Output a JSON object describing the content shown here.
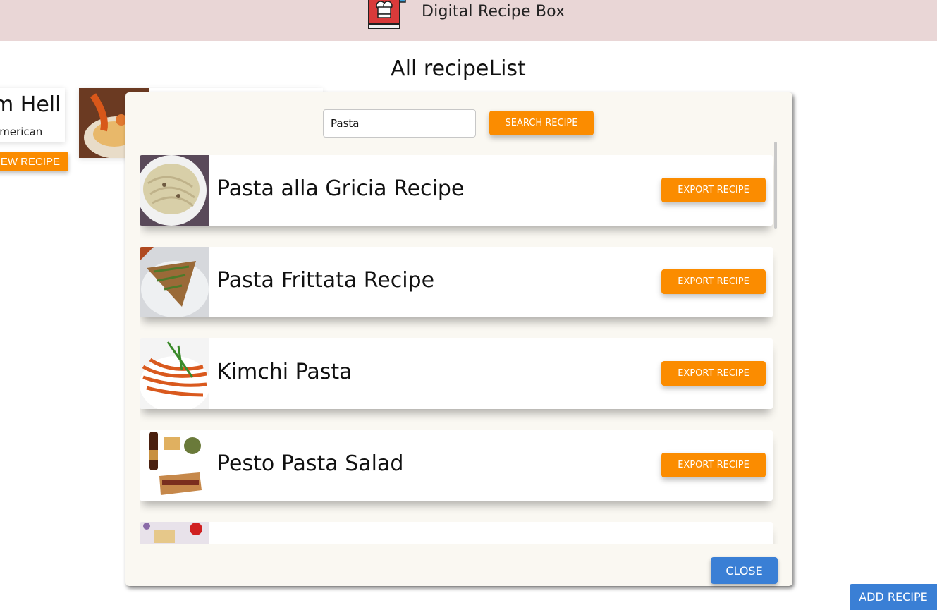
{
  "header": {
    "title": "Digital Recipe Box",
    "logo_icon": "chef-recipe-book-icon"
  },
  "page": {
    "title": "All recipeList"
  },
  "background_cards": [
    {
      "title": "m Hell",
      "cuisine": "american",
      "button": "EW RECIPE"
    }
  ],
  "modal": {
    "search": {
      "value": "Pasta",
      "button": "SEARCH RECIPE"
    },
    "results": [
      {
        "name": "Pasta alla Gricia Recipe",
        "button": "EXPORT RECIPE"
      },
      {
        "name": "Pasta Frittata Recipe",
        "button": "EXPORT RECIPE"
      },
      {
        "name": "Kimchi Pasta",
        "button": "EXPORT RECIPE"
      },
      {
        "name": "Pesto Pasta Salad",
        "button": "EXPORT RECIPE"
      },
      {
        "name": "",
        "button": ""
      }
    ],
    "close_button": "CLOSE"
  },
  "add_button": "ADD RECIPE",
  "colors": {
    "accent_orange": "#fb8c00",
    "primary_blue": "#3a7fd5",
    "header_bg": "#e9d6d6",
    "modal_bg": "#faf8f2"
  }
}
